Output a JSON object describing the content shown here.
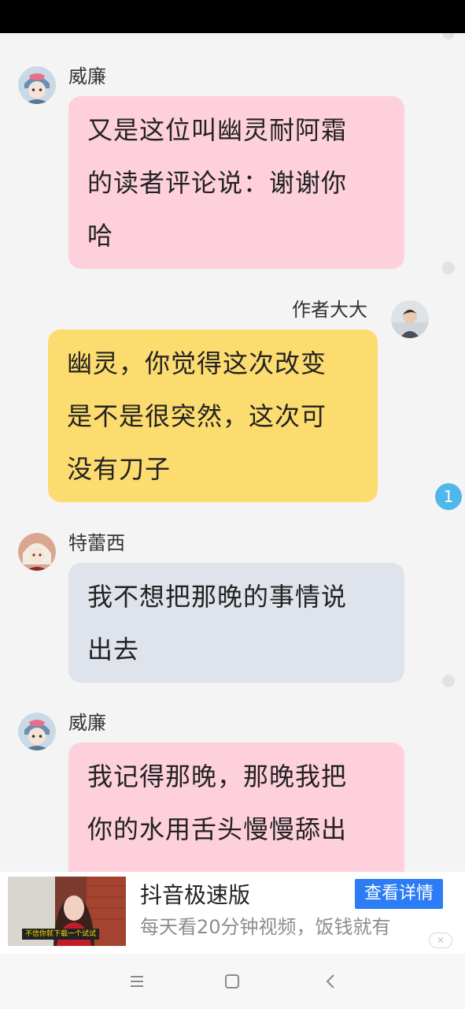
{
  "messages": [
    {
      "sender": "威廉",
      "side": "left",
      "color": "pink",
      "lines": [
        "又是这位叫幽灵耐阿霜",
        "的读者评论说：谢谢你",
        "哈"
      ]
    },
    {
      "sender": "作者大大",
      "side": "right",
      "color": "yellow",
      "lines": [
        "幽灵，你觉得这次改变",
        "是不是很突然，这次可",
        "没有刀子"
      ]
    },
    {
      "sender": "特蕾西",
      "side": "left",
      "color": "grey",
      "lines": [
        "我不想把那晚的事情说",
        "出去"
      ]
    },
    {
      "sender": "威廉",
      "side": "left",
      "color": "pink",
      "lines": [
        "我记得那晚，那晚我把",
        "你的水用舌头慢慢舔出"
      ]
    }
  ],
  "unread_count": "1",
  "ad": {
    "title": "抖音极速版",
    "subtitle": "每天看20分钟视频，饭钱就有",
    "cta": "查看详情",
    "thumb_caption": "不信你就下载一个试试",
    "close": "✕"
  },
  "nav": {
    "menu_icon": "menu-icon",
    "home_icon": "home-square-icon",
    "back_icon": "back-chevron-icon"
  },
  "colors": {
    "pink_bubble": "#fdd0dc",
    "yellow_bubble": "#fcdb6f",
    "grey_bubble": "#dfe4ec",
    "badge": "#50b7ea",
    "cta": "#2c7cf6"
  }
}
